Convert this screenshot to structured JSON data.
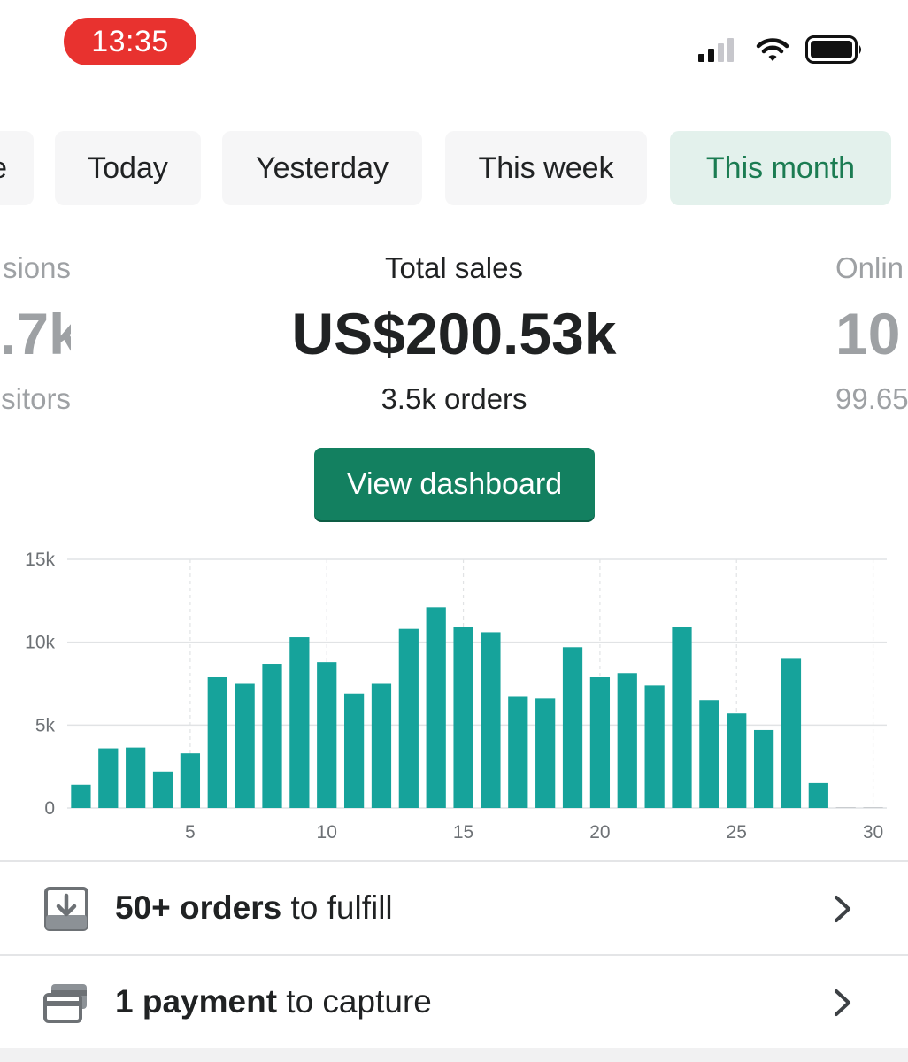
{
  "status_bar": {
    "time": "13:35",
    "icons": [
      "cellular-signal-icon",
      "wifi-icon",
      "battery-icon"
    ]
  },
  "date_tabs": [
    {
      "label": "e",
      "active": false
    },
    {
      "label": "Today",
      "active": false
    },
    {
      "label": "Yesterday",
      "active": false
    },
    {
      "label": "This week",
      "active": false
    },
    {
      "label": "This month",
      "active": true
    }
  ],
  "metrics": {
    "left": {
      "label": "sions",
      "value": ".7k",
      "sub": "sitors"
    },
    "center": {
      "label": "Total sales",
      "value": "US$200.53k",
      "sub": "3.5k orders"
    },
    "right": {
      "label": "Onlin",
      "value": "10",
      "sub": "99.65"
    }
  },
  "view_dashboard_label": "View dashboard",
  "chart_data": {
    "type": "bar",
    "x": [
      1,
      2,
      3,
      4,
      5,
      6,
      7,
      8,
      9,
      10,
      11,
      12,
      13,
      14,
      15,
      16,
      17,
      18,
      19,
      20,
      21,
      22,
      23,
      24,
      25,
      26,
      27,
      28,
      29,
      30
    ],
    "values": [
      1400,
      3600,
      3650,
      2200,
      3300,
      7900,
      7500,
      8700,
      10300,
      8800,
      6900,
      7500,
      10800,
      12100,
      10900,
      10600,
      6700,
      6600,
      9700,
      7900,
      8100,
      7400,
      10900,
      6500,
      5700,
      4700,
      9000,
      1500,
      0,
      0
    ],
    "y_ticks": [
      "0",
      "5k",
      "10k",
      "15k"
    ],
    "x_ticks": [
      "5",
      "10",
      "15",
      "20",
      "25",
      "30"
    ],
    "ylim": [
      0,
      15000
    ],
    "xlim": [
      0.5,
      30.5
    ],
    "bar_color": "#16a39b",
    "grid": true
  },
  "action_rows": [
    {
      "icon": "download-tray-icon",
      "bold": "50+ orders",
      "rest": " to fulfill"
    },
    {
      "icon": "credit-card-icon",
      "bold": "1 payment",
      "rest": " to capture"
    }
  ],
  "colors": {
    "accent": "#138060",
    "active_tab_bg": "#e3f1ec",
    "active_tab_text": "#1b7c52",
    "time_pill": "#e8322f"
  }
}
